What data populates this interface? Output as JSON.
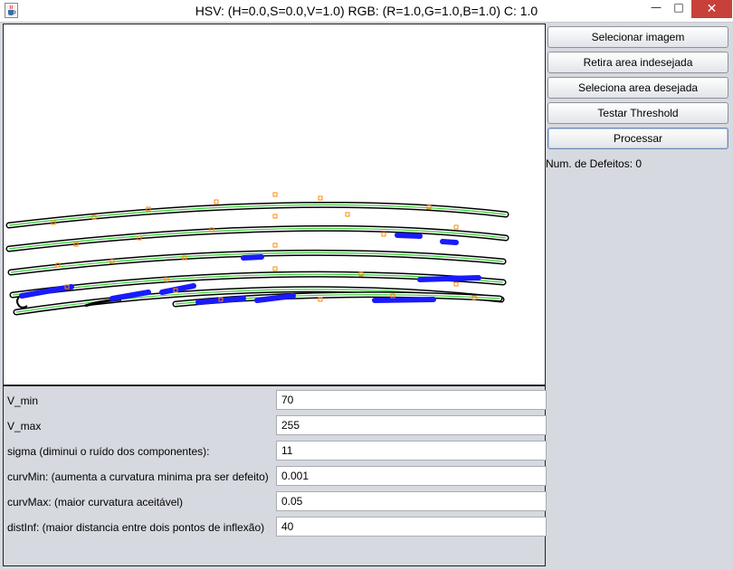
{
  "window": {
    "title": "HSV: (H=0.0,S=0.0,V=1.0) RGB: (R=1.0,G=1.0,B=1.0) C: 1.0",
    "minimize_symbol": "—",
    "maximize_symbol": "□",
    "close_symbol": "✕",
    "app_icon": "java-cup-icon"
  },
  "sidebar": {
    "buttons": [
      {
        "label": "Selecionar imagem"
      },
      {
        "label": "Retira area indesejada"
      },
      {
        "label": "Seleciona area desejada"
      },
      {
        "label": "Testar Threshold"
      },
      {
        "label": "Processar"
      }
    ],
    "defects_label": "Num. de Defeitos: 0"
  },
  "params": [
    {
      "label": "V_min",
      "value": "70"
    },
    {
      "label": "V_max",
      "value": "255"
    },
    {
      "label": "sigma (diminui o ruído dos componentes):",
      "value": "11"
    },
    {
      "label": "curvMin: (aumenta a curvatura minima pra ser defeito)",
      "value": "0.001"
    },
    {
      "label": "curvMax: (maior curvatura aceitável)",
      "value": "0.05"
    },
    {
      "label": "distInf: (maior distancia entre dois pontos de inflexão)",
      "value": "40"
    }
  ],
  "colors": {
    "titlebar_bg": "#ffffff",
    "close_button": "#c7403a",
    "panel_bg": "#d6d9df",
    "canvas_bg": "#ffffff",
    "strip_outline": "#000000",
    "strip_center_line": "#33cc33",
    "defect_marker": "#1a1aff",
    "inflection_marker": "#ff8800"
  }
}
